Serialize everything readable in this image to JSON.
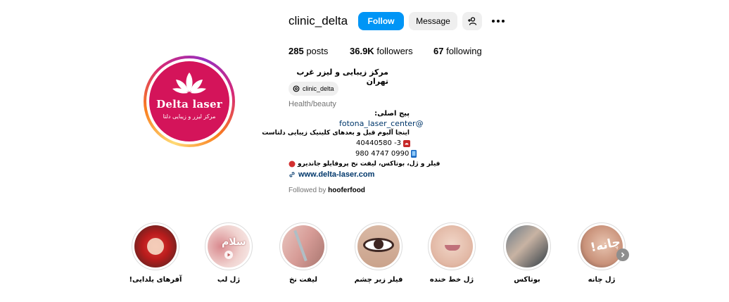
{
  "profile": {
    "username": "clinic_delta",
    "follow_label": "Follow",
    "message_label": "Message",
    "avatar": {
      "brand": "Delta laser",
      "subtitle": "مرکز لیزر و زیبایی دلتا"
    },
    "stats": {
      "posts": "285",
      "posts_label": "posts",
      "followers": "36.9K",
      "followers_label": "followers",
      "following": "67",
      "following_label": "following"
    },
    "bio_name": "مرکز زیبایی و لیزر غرب تهران",
    "threads_handle": "clinic_delta",
    "category": "Health/beauty",
    "bio_lines": {
      "l1": "پیج اصلی:",
      "l2": "fotona_laser_center@",
      "l3": "اینجا آلبوم قبل و بعدهای کلینیک زیبایی دلتاست",
      "l4": "40440580 -3",
      "l5": "980 4747 0990",
      "l6": "فیلر و ژل، بوتاکس، لیفت نخ پروفایلو جاندیرو"
    },
    "website": "www.delta-laser.com",
    "followed_prefix": "Followed by ",
    "followed_by": "hooferfood"
  },
  "highlights": [
    {
      "label": "ژل چانه",
      "overlay": "چانه!"
    },
    {
      "label": "بوتاکس"
    },
    {
      "label": "ژل خط خنده"
    },
    {
      "label": "فیلر زیر چشم"
    },
    {
      "label": "لیفت نخ"
    },
    {
      "label": "ژل لب",
      "overlay": "سلام"
    },
    {
      "label": "آفرهای یلدایی!"
    }
  ],
  "colors": {
    "accent": "#0095f6",
    "brand": "#d4145a",
    "link": "#00376b",
    "muted": "#737373"
  },
  "icons": [
    "add-user-icon",
    "more-icon",
    "threads-icon",
    "link-icon",
    "phone-icon",
    "mobile-icon",
    "red-dot-icon",
    "chevron-right-icon"
  ]
}
